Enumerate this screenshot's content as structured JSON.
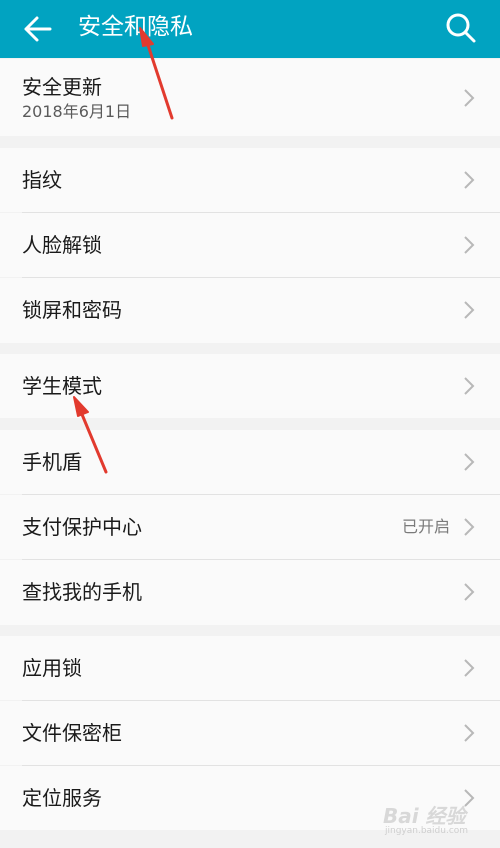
{
  "header": {
    "title": "安全和隐私",
    "back_icon": "back-arrow-icon",
    "search_icon": "search-icon",
    "background": "#01a3c1"
  },
  "rows": {
    "security_update": {
      "label": "安全更新",
      "date": "2018年6月1日"
    },
    "fingerprint": {
      "label": "指纹"
    },
    "face_unlock": {
      "label": "人脸解锁"
    },
    "lock_screen": {
      "label": "锁屏和密码"
    },
    "student_mode": {
      "label": "学生模式"
    },
    "phone_shield": {
      "label": "手机盾"
    },
    "payment_protection": {
      "label": "支付保护中心",
      "status": "已开启"
    },
    "find_my_phone": {
      "label": "查找我的手机"
    },
    "app_lock": {
      "label": "应用锁"
    },
    "file_safe": {
      "label": "文件保密柜"
    },
    "location_service": {
      "label": "定位服务"
    }
  },
  "watermark": {
    "main": "Bai 经验",
    "sub": "jingyan.baidu.com"
  },
  "colors": {
    "annotation_arrow": "#e23a2e",
    "chevron": "#b8b8b8"
  }
}
